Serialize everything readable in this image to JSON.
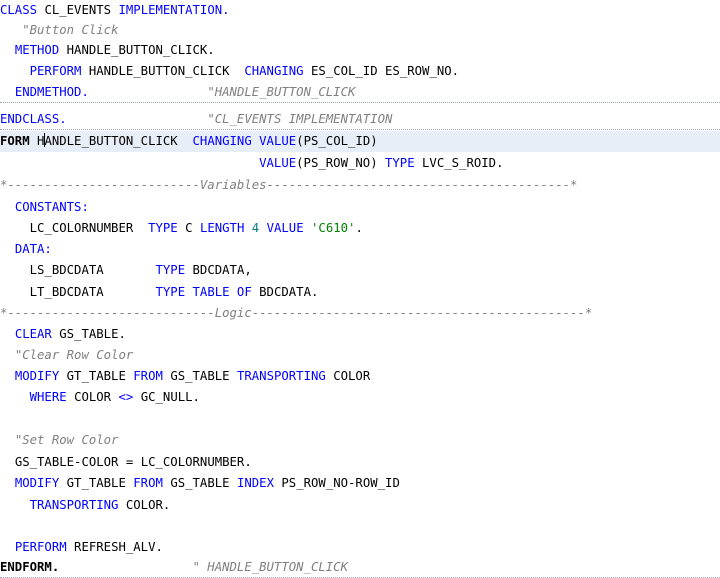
{
  "code": {
    "l1": {
      "class": "CLASS",
      "name": "CL_EVENTS",
      "impl": "IMPLEMENTATION."
    },
    "l2": {
      "comment": "\"Button Click"
    },
    "l3": {
      "method": "METHOD",
      "name": "HANDLE_BUTTON_CLICK."
    },
    "l4": {
      "perform": "PERFORM",
      "name": "HANDLE_BUTTON_CLICK",
      "changing": "CHANGING",
      "args": "ES_COL_ID ES_ROW_NO."
    },
    "l5": {
      "endmethod": "ENDMETHOD.",
      "comment": "\"HANDLE_BUTTON_CLICK"
    },
    "l6": {
      "endclass": "ENDCLASS.",
      "comment": "\"CL_EVENTS IMPLEMENTATION"
    },
    "l7": {
      "form": "FORM",
      "name_h": "H",
      "name_rest": "ANDLE_BUTTON_CLICK",
      "changing": "CHANGING",
      "value": "VALUE",
      "param": "(PS_COL_ID)"
    },
    "l8": {
      "value": "VALUE",
      "param": "(PS_ROW_NO)",
      "type": "TYPE",
      "typename": "LVC_S_ROID."
    },
    "l9": {
      "text": "*--------------------------Variables-----------------------------------------*"
    },
    "l10": {
      "constants": "CONSTANTS:"
    },
    "l11": {
      "name": "LC_COLORNUMBER",
      "type": "TYPE",
      "c": "C",
      "length": "LENGTH",
      "num": "4",
      "value": "VALUE",
      "str": "'C610'",
      "dot": "."
    },
    "l12": {
      "data": "DATA:"
    },
    "l13": {
      "name": "LS_BDCDATA",
      "type": "TYPE",
      "typename": "BDCDATA,"
    },
    "l14": {
      "name": "LT_BDCDATA",
      "type": "TYPE TABLE OF",
      "typename": "BDCDATA."
    },
    "l15": {
      "text": "*----------------------------Logic---------------------------------------------*"
    },
    "l16": {
      "clear": "CLEAR",
      "name": "GS_TABLE."
    },
    "l17": {
      "comment": "\"Clear Row Color"
    },
    "l18": {
      "modify": "MODIFY",
      "tbl": "GT_TABLE",
      "from": "FROM",
      "wa": "GS_TABLE",
      "transporting": "TRANSPORTING",
      "field": "COLOR"
    },
    "l19": {
      "where": "WHERE",
      "field": "COLOR",
      "op": "<>",
      "val": "GC_NULL."
    },
    "l21": {
      "comment": "\"Set Row Color"
    },
    "l22": {
      "lhs": "GS_TABLE-COLOR",
      "eq": "=",
      "rhs": "LC_COLORNUMBER."
    },
    "l23": {
      "modify": "MODIFY",
      "tbl": "GT_TABLE",
      "from": "FROM",
      "wa": "GS_TABLE",
      "index": "INDEX",
      "idx": "PS_ROW_NO-ROW_ID"
    },
    "l24": {
      "transporting": "TRANSPORTING",
      "field": "COLOR."
    },
    "l26": {
      "perform": "PERFORM",
      "name": "REFRESH_ALV."
    },
    "l27": {
      "endform": "ENDFORM.",
      "comment": "\" HANDLE_BUTTON_CLICK"
    }
  }
}
